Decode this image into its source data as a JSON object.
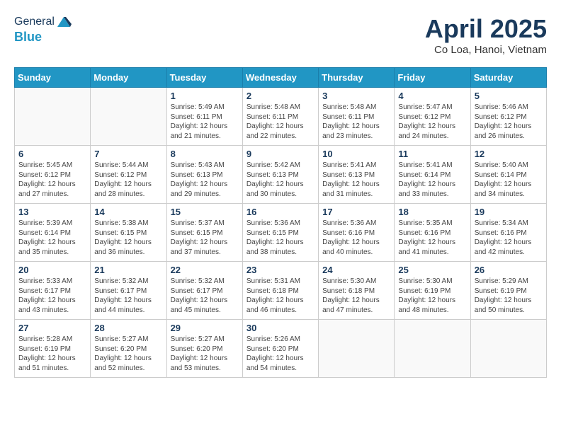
{
  "header": {
    "logo_general": "General",
    "logo_blue": "Blue",
    "month_title": "April 2025",
    "location": "Co Loa, Hanoi, Vietnam"
  },
  "days_of_week": [
    "Sunday",
    "Monday",
    "Tuesday",
    "Wednesday",
    "Thursday",
    "Friday",
    "Saturday"
  ],
  "weeks": [
    [
      {
        "day": "",
        "info": ""
      },
      {
        "day": "",
        "info": ""
      },
      {
        "day": "1",
        "info": "Sunrise: 5:49 AM\nSunset: 6:11 PM\nDaylight: 12 hours and 21 minutes."
      },
      {
        "day": "2",
        "info": "Sunrise: 5:48 AM\nSunset: 6:11 PM\nDaylight: 12 hours and 22 minutes."
      },
      {
        "day": "3",
        "info": "Sunrise: 5:48 AM\nSunset: 6:11 PM\nDaylight: 12 hours and 23 minutes."
      },
      {
        "day": "4",
        "info": "Sunrise: 5:47 AM\nSunset: 6:12 PM\nDaylight: 12 hours and 24 minutes."
      },
      {
        "day": "5",
        "info": "Sunrise: 5:46 AM\nSunset: 6:12 PM\nDaylight: 12 hours and 26 minutes."
      }
    ],
    [
      {
        "day": "6",
        "info": "Sunrise: 5:45 AM\nSunset: 6:12 PM\nDaylight: 12 hours and 27 minutes."
      },
      {
        "day": "7",
        "info": "Sunrise: 5:44 AM\nSunset: 6:12 PM\nDaylight: 12 hours and 28 minutes."
      },
      {
        "day": "8",
        "info": "Sunrise: 5:43 AM\nSunset: 6:13 PM\nDaylight: 12 hours and 29 minutes."
      },
      {
        "day": "9",
        "info": "Sunrise: 5:42 AM\nSunset: 6:13 PM\nDaylight: 12 hours and 30 minutes."
      },
      {
        "day": "10",
        "info": "Sunrise: 5:41 AM\nSunset: 6:13 PM\nDaylight: 12 hours and 31 minutes."
      },
      {
        "day": "11",
        "info": "Sunrise: 5:41 AM\nSunset: 6:14 PM\nDaylight: 12 hours and 33 minutes."
      },
      {
        "day": "12",
        "info": "Sunrise: 5:40 AM\nSunset: 6:14 PM\nDaylight: 12 hours and 34 minutes."
      }
    ],
    [
      {
        "day": "13",
        "info": "Sunrise: 5:39 AM\nSunset: 6:14 PM\nDaylight: 12 hours and 35 minutes."
      },
      {
        "day": "14",
        "info": "Sunrise: 5:38 AM\nSunset: 6:15 PM\nDaylight: 12 hours and 36 minutes."
      },
      {
        "day": "15",
        "info": "Sunrise: 5:37 AM\nSunset: 6:15 PM\nDaylight: 12 hours and 37 minutes."
      },
      {
        "day": "16",
        "info": "Sunrise: 5:36 AM\nSunset: 6:15 PM\nDaylight: 12 hours and 38 minutes."
      },
      {
        "day": "17",
        "info": "Sunrise: 5:36 AM\nSunset: 6:16 PM\nDaylight: 12 hours and 40 minutes."
      },
      {
        "day": "18",
        "info": "Sunrise: 5:35 AM\nSunset: 6:16 PM\nDaylight: 12 hours and 41 minutes."
      },
      {
        "day": "19",
        "info": "Sunrise: 5:34 AM\nSunset: 6:16 PM\nDaylight: 12 hours and 42 minutes."
      }
    ],
    [
      {
        "day": "20",
        "info": "Sunrise: 5:33 AM\nSunset: 6:17 PM\nDaylight: 12 hours and 43 minutes."
      },
      {
        "day": "21",
        "info": "Sunrise: 5:32 AM\nSunset: 6:17 PM\nDaylight: 12 hours and 44 minutes."
      },
      {
        "day": "22",
        "info": "Sunrise: 5:32 AM\nSunset: 6:17 PM\nDaylight: 12 hours and 45 minutes."
      },
      {
        "day": "23",
        "info": "Sunrise: 5:31 AM\nSunset: 6:18 PM\nDaylight: 12 hours and 46 minutes."
      },
      {
        "day": "24",
        "info": "Sunrise: 5:30 AM\nSunset: 6:18 PM\nDaylight: 12 hours and 47 minutes."
      },
      {
        "day": "25",
        "info": "Sunrise: 5:30 AM\nSunset: 6:19 PM\nDaylight: 12 hours and 48 minutes."
      },
      {
        "day": "26",
        "info": "Sunrise: 5:29 AM\nSunset: 6:19 PM\nDaylight: 12 hours and 50 minutes."
      }
    ],
    [
      {
        "day": "27",
        "info": "Sunrise: 5:28 AM\nSunset: 6:19 PM\nDaylight: 12 hours and 51 minutes."
      },
      {
        "day": "28",
        "info": "Sunrise: 5:27 AM\nSunset: 6:20 PM\nDaylight: 12 hours and 52 minutes."
      },
      {
        "day": "29",
        "info": "Sunrise: 5:27 AM\nSunset: 6:20 PM\nDaylight: 12 hours and 53 minutes."
      },
      {
        "day": "30",
        "info": "Sunrise: 5:26 AM\nSunset: 6:20 PM\nDaylight: 12 hours and 54 minutes."
      },
      {
        "day": "",
        "info": ""
      },
      {
        "day": "",
        "info": ""
      },
      {
        "day": "",
        "info": ""
      }
    ]
  ]
}
